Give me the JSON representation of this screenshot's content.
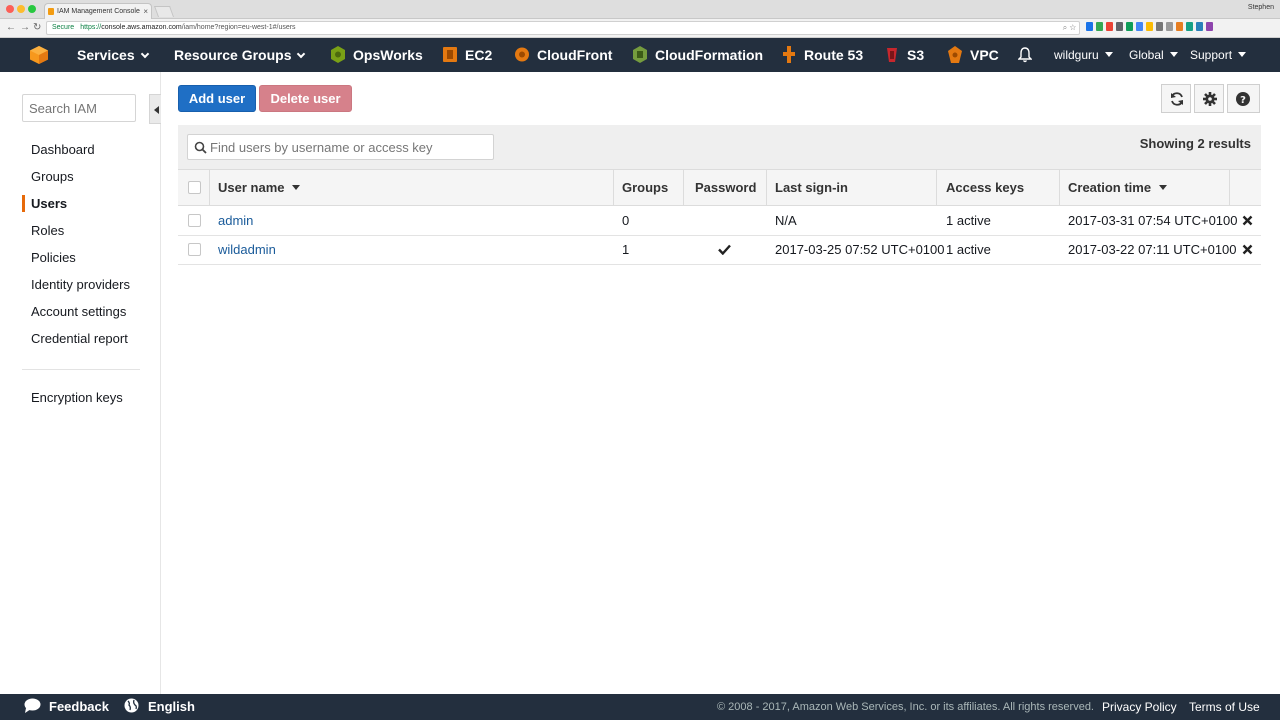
{
  "browser": {
    "tab_title": "IAM Management Console",
    "profile_name": "Stephen",
    "secure_label": "Secure",
    "url_scheme": "https://",
    "url_host": "console.aws.amazon.com",
    "url_path": "/iam/home?region=eu-west-1#/users"
  },
  "nav": {
    "services": "Services",
    "resource_groups": "Resource Groups",
    "shortcuts": [
      {
        "label": "OpsWorks",
        "icon": "opsworks-icon"
      },
      {
        "label": "EC2",
        "icon": "ec2-icon"
      },
      {
        "label": "CloudFront",
        "icon": "cloudfront-icon"
      },
      {
        "label": "CloudFormation",
        "icon": "cloudformation-icon"
      },
      {
        "label": "Route 53",
        "icon": "route53-icon"
      },
      {
        "label": "S3",
        "icon": "s3-icon"
      },
      {
        "label": "VPC",
        "icon": "vpc-icon"
      }
    ],
    "account": "wildguru",
    "region": "Global",
    "support": "Support"
  },
  "sidebar": {
    "search_placeholder": "Search IAM",
    "items": [
      {
        "label": "Dashboard"
      },
      {
        "label": "Groups"
      },
      {
        "label": "Users",
        "active": true
      },
      {
        "label": "Roles"
      },
      {
        "label": "Policies"
      },
      {
        "label": "Identity providers"
      },
      {
        "label": "Account settings"
      },
      {
        "label": "Credential report"
      }
    ],
    "secondary": [
      {
        "label": "Encryption keys"
      }
    ]
  },
  "toolbar": {
    "add_user": "Add user",
    "delete_user": "Delete user"
  },
  "filter": {
    "placeholder": "Find users by username or access key",
    "results": "Showing 2 results"
  },
  "table": {
    "columns": [
      "User name",
      "Groups",
      "Password",
      "Last sign-in",
      "Access keys",
      "Creation time"
    ],
    "rows": [
      {
        "user_name": "admin",
        "groups": "0",
        "password": false,
        "last_sign_in": "N/A",
        "access_keys": "1 active",
        "creation_time": "2017-03-31 07:54 UTC+0100"
      },
      {
        "user_name": "wildadmin",
        "groups": "1",
        "password": true,
        "last_sign_in": "2017-03-25 07:52 UTC+0100",
        "access_keys": "1 active",
        "creation_time": "2017-03-22 07:11 UTC+0100"
      }
    ]
  },
  "footer": {
    "feedback": "Feedback",
    "language": "English",
    "copyright": "© 2008 - 2017, Amazon Web Services, Inc. or its affiliates. All rights reserved.",
    "privacy": "Privacy Policy",
    "terms": "Terms of Use"
  },
  "colors": {
    "nav_bg": "#232f3e",
    "primary_button": "#1f6fc5",
    "danger_button_disabled": "#d6818b",
    "active_accent": "#e76a0a",
    "link": "#1a5b9a"
  }
}
